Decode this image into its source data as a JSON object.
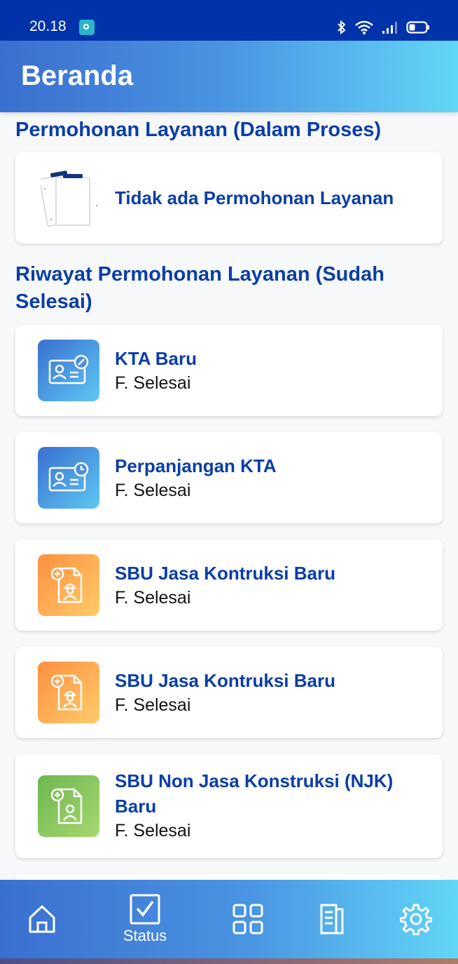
{
  "status_bar": {
    "time": "20.18"
  },
  "app_bar": {
    "title": "Beranda"
  },
  "in_process": {
    "title": "Permohonan Layanan (Dalam Proses)",
    "empty_text": "Tidak ada Permohonan Layanan"
  },
  "history": {
    "title": "Riwayat Permohonan Layanan (Sudah Selesai)",
    "items": [
      {
        "title": "KTA Baru",
        "status": "F. Selesai",
        "icon": "id-card-edit-icon",
        "color": "blue"
      },
      {
        "title": "Perpanjangan KTA",
        "status": "F. Selesai",
        "icon": "id-card-clock-icon",
        "color": "blue"
      },
      {
        "title": "SBU Jasa Kontruksi Baru",
        "status": "F. Selesai",
        "icon": "worker-document-icon",
        "color": "orange"
      },
      {
        "title": "SBU Jasa Kontruksi Baru",
        "status": "F. Selesai",
        "icon": "worker-document-icon",
        "color": "orange"
      },
      {
        "title": "SBU Non Jasa Konstruksi (NJK) Baru",
        "status": "F. Selesai",
        "icon": "person-document-icon",
        "color": "green"
      }
    ]
  },
  "bottom_nav": {
    "items": [
      {
        "icon": "home-icon",
        "label": ""
      },
      {
        "icon": "checkbox-icon",
        "label": "Status"
      },
      {
        "icon": "grid-icon",
        "label": ""
      },
      {
        "icon": "document-icon",
        "label": ""
      },
      {
        "icon": "gear-icon",
        "label": ""
      }
    ]
  },
  "colors": {
    "status_bar": "#0033aa",
    "heading": "#0a3ea5",
    "gradient_start": "#3a6fd0",
    "gradient_end": "#62d6f7"
  }
}
